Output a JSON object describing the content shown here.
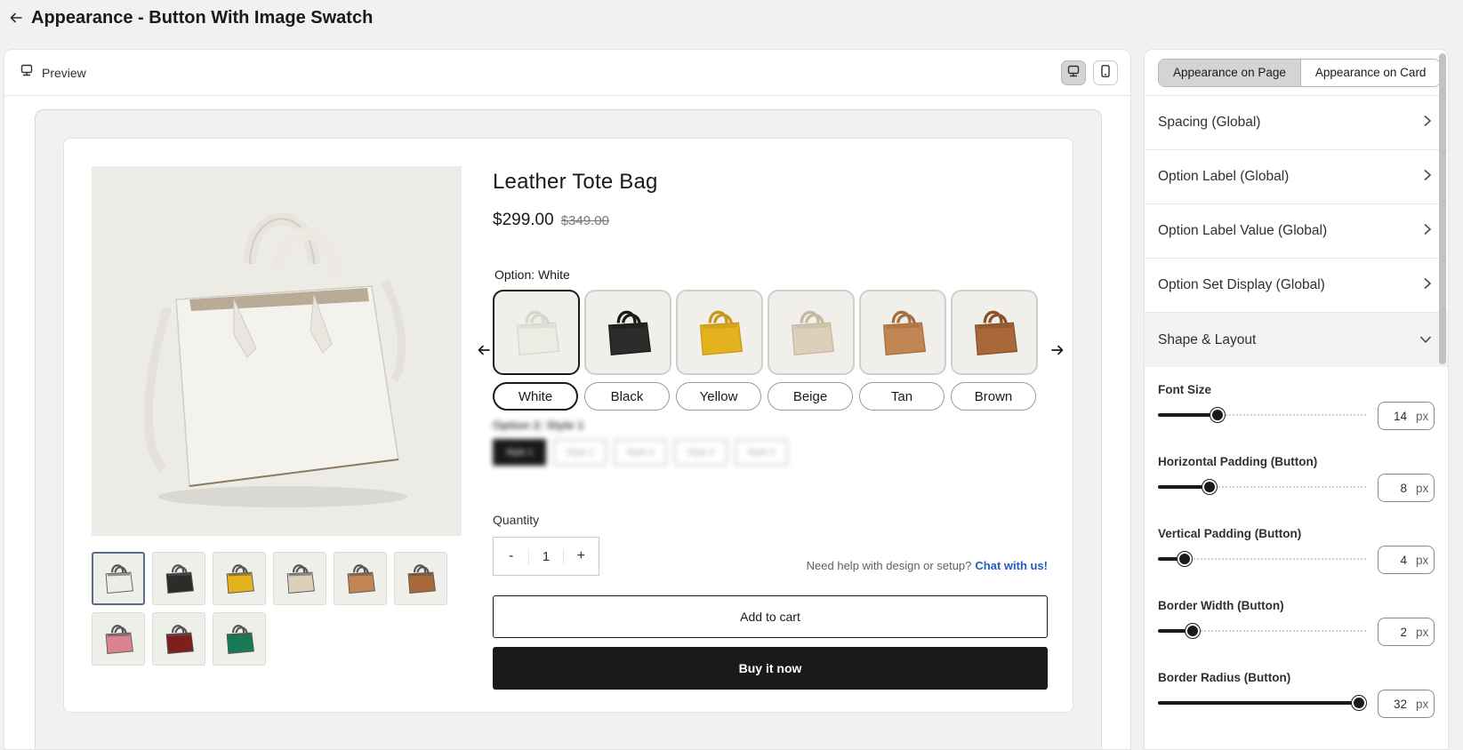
{
  "header": {
    "title": "Appearance - Button With Image Swatch"
  },
  "preview": {
    "label": "Preview",
    "device_desktop": "desktop-icon",
    "device_mobile": "mobile-icon"
  },
  "product": {
    "title": "Leather Tote Bag",
    "price": "$299.00",
    "compare_price": "$349.00",
    "option_label_prefix": "Option: ",
    "option_label_value": "White",
    "swatches": [
      {
        "label": "White",
        "color": "#ecebe4",
        "dark": "#d7d6cd"
      },
      {
        "label": "Black",
        "color": "#2c2c2a",
        "dark": "#1a1a19"
      },
      {
        "label": "Yellow",
        "color": "#e3b21c",
        "dark": "#c9971a"
      },
      {
        "label": "Beige",
        "color": "#ddd0bb",
        "dark": "#c7b9a1"
      },
      {
        "label": "Tan",
        "color": "#c18654",
        "dark": "#a76f40"
      },
      {
        "label": "Brown",
        "color": "#a86839",
        "dark": "#8a512a"
      }
    ],
    "thumbnails": [
      {
        "color": "#ecebe4"
      },
      {
        "color": "#2c2c2a"
      },
      {
        "color": "#e3b21c"
      },
      {
        "color": "#ddd0bb"
      },
      {
        "color": "#c18654"
      },
      {
        "color": "#a86839"
      },
      {
        "color": "#d9848e"
      },
      {
        "color": "#7d1f1c"
      },
      {
        "color": "#177a57"
      }
    ],
    "option2_label": "Option 2: Style 1",
    "option2_values": [
      "Style 1",
      "Style 2",
      "Style 3",
      "Style 4",
      "Style 5"
    ],
    "quantity_label": "Quantity",
    "quantity_value": "1",
    "qty_minus": "-",
    "qty_plus": "+",
    "help_text": "Need help with design or setup?",
    "help_link": "Chat with us!",
    "add_to_cart": "Add to cart",
    "buy_now": "Buy it now"
  },
  "settings": {
    "tabs": [
      "Appearance on Page",
      "Appearance on Card"
    ],
    "active_tab": "Appearance on Page",
    "sections": [
      "Spacing (Global)",
      "Option Label (Global)",
      "Option Label Value (Global)",
      "Option Set Display (Global)",
      "Shape & Layout"
    ],
    "controls": [
      {
        "label": "Font Size",
        "value": "14",
        "unit": "px",
        "fraction": 0.27
      },
      {
        "label": "Horizontal Padding (Button)",
        "value": "8",
        "unit": "px",
        "fraction": 0.23
      },
      {
        "label": "Vertical Padding (Button)",
        "value": "4",
        "unit": "px",
        "fraction": 0.1
      },
      {
        "label": "Border Width (Button)",
        "value": "2",
        "unit": "px",
        "fraction": 0.14
      },
      {
        "label": "Border Radius (Button)",
        "value": "32",
        "unit": "px",
        "fraction": 1.0
      }
    ]
  },
  "colors": {
    "accent": "#1a1a1a",
    "link": "#1f5fbf",
    "background": "#f1f1f1"
  }
}
